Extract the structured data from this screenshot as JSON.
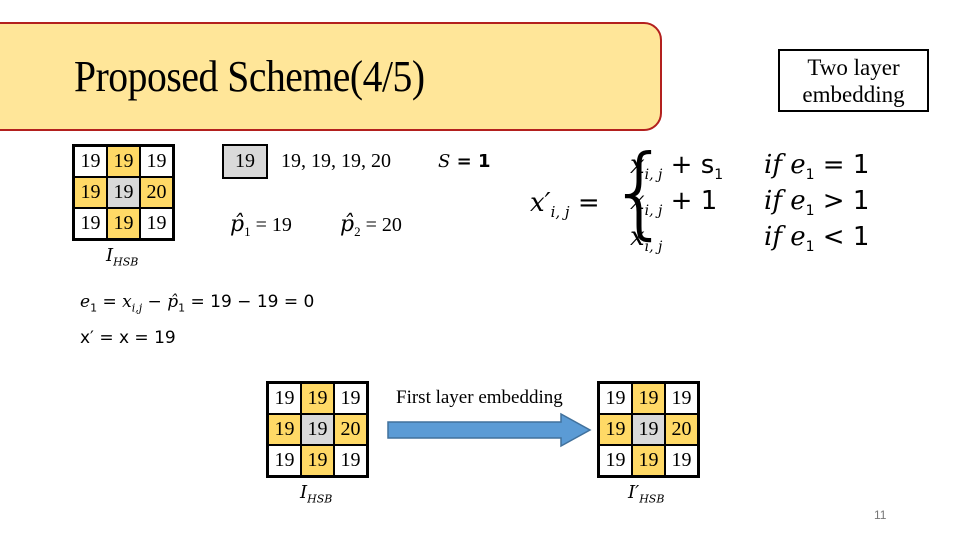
{
  "slide": {
    "title": "Proposed Scheme(4/5)",
    "side_label": "Two layer embedding",
    "side_label_line1": "Two layer",
    "side_label_line2": "embedding",
    "page_number": "11",
    "colors": {
      "title_fill": "#ffe699",
      "title_border": "#b3201e",
      "neighbor_cell": "#ffd966",
      "center_cell": "#d9d9d9",
      "arrow_fill": "#5b9bd5",
      "arrow_border": "#41719c"
    }
  },
  "grid_top": {
    "caption_main": "I",
    "caption_sub": "HSB",
    "cells": [
      "19",
      "19",
      "19",
      "19",
      "19",
      "20",
      "19",
      "19",
      "19"
    ],
    "cell_types": [
      "w",
      "y",
      "w",
      "y",
      "g",
      "y",
      "w",
      "y",
      "w"
    ]
  },
  "prediction": {
    "center_value": "19",
    "neighbors": "19, 19, 19, 20",
    "s_label": "S",
    "s_eq": "= 1",
    "p1_label": "p̂",
    "p1_sub": "1",
    "p1_eq": "= 19",
    "p2_label": "p̂",
    "p2_sub": "2",
    "p2_eq": "= 20"
  },
  "piecewise": {
    "lhs": "x′",
    "lhs_sub": "i, j",
    "eq": "=",
    "cases": [
      {
        "expr": "x",
        "sub": "i, j",
        "tail": " + s",
        "tail_sub": "1",
        "cond": "if e",
        "cond_sub": "1",
        "cond_tail": " = 1"
      },
      {
        "expr": "x",
        "sub": "i, j",
        "tail": " + 1",
        "tail_sub": "",
        "cond": "if e",
        "cond_sub": "1",
        "cond_tail": " > 1"
      },
      {
        "expr": "x",
        "sub": "i, j",
        "tail": "",
        "tail_sub": "",
        "cond": "if e",
        "cond_sub": "1",
        "cond_tail": " < 1"
      }
    ]
  },
  "equations": {
    "line1_a": "e",
    "line1_a_sub": "1",
    "line1_b": " = x",
    "line1_b_sub": "i,j",
    "line1_c": " − p̂",
    "line1_c_sub": "1",
    "line1_d": " = 19 − 19 = 0",
    "line2": "x′ = x = 19"
  },
  "bottom": {
    "left_grid": {
      "caption_main": "I",
      "caption_sub": "HSB",
      "cells": [
        "19",
        "19",
        "19",
        "19",
        "19",
        "20",
        "19",
        "19",
        "19"
      ]
    },
    "arrow_label": "First layer embedding",
    "right_grid": {
      "caption_main": "I′",
      "caption_sub": "HSB",
      "cells": [
        "19",
        "19",
        "19",
        "19",
        "19",
        "20",
        "19",
        "19",
        "19"
      ]
    }
  }
}
